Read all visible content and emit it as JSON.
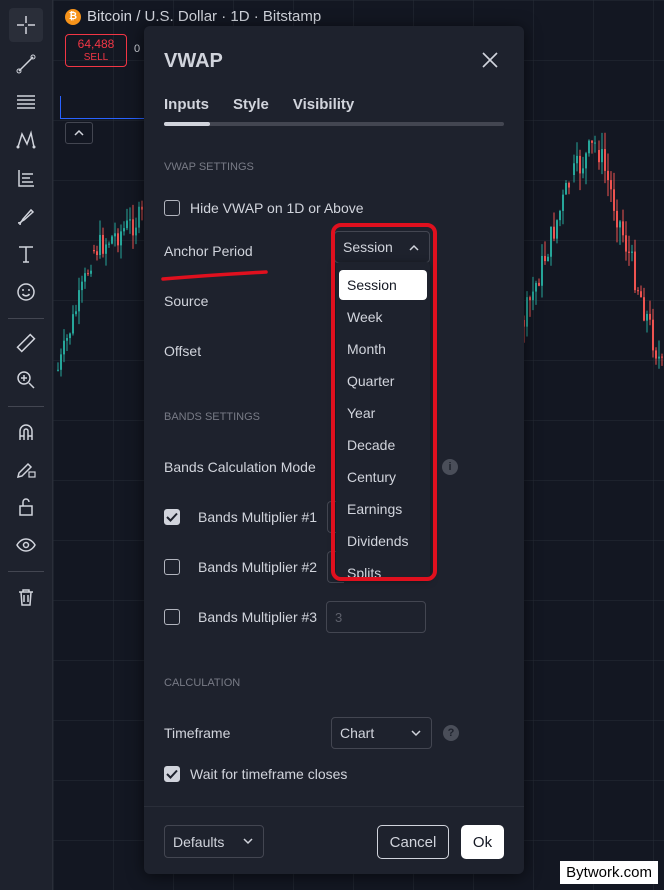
{
  "chart": {
    "symbol_title": "Bitcoin / U.S. Dollar · 1D · Bitstamp",
    "sell_price": "64,488",
    "sell_label": "SELL",
    "spread": "0"
  },
  "dialog": {
    "title": "VWAP",
    "tabs": [
      "Inputs",
      "Style",
      "Visibility"
    ],
    "active_tab": "Inputs",
    "vwap_settings": {
      "section_label": "VWAP SETTINGS",
      "hide_label": "Hide VWAP on 1D or Above",
      "hide_checked": false,
      "anchor_label": "Anchor Period",
      "anchor_value": "Session",
      "source_label": "Source",
      "offset_label": "Offset"
    },
    "bands_settings": {
      "section_label": "BANDS SETTINGS",
      "calc_mode_label": "Bands Calculation Mode",
      "multipliers": [
        {
          "label": "Bands Multiplier #1",
          "checked": true
        },
        {
          "label": "Bands Multiplier #2",
          "checked": false
        },
        {
          "label": "Bands Multiplier #3",
          "checked": false,
          "value": "3"
        }
      ]
    },
    "calculation": {
      "section_label": "CALCULATION",
      "timeframe_label": "Timeframe",
      "timeframe_value": "Chart",
      "wait_label": "Wait for timeframe closes",
      "wait_checked": true
    },
    "footer": {
      "defaults_label": "Defaults",
      "cancel_label": "Cancel",
      "ok_label": "Ok"
    }
  },
  "anchor_dropdown": {
    "options": [
      "Session",
      "Week",
      "Month",
      "Quarter",
      "Year",
      "Decade",
      "Century",
      "Earnings",
      "Dividends",
      "Splits"
    ],
    "selected": "Session"
  },
  "watermark": "Bytwork.com",
  "colors": {
    "up": "#26a69a",
    "down": "#ef5350",
    "annotation": "#e0101e"
  }
}
